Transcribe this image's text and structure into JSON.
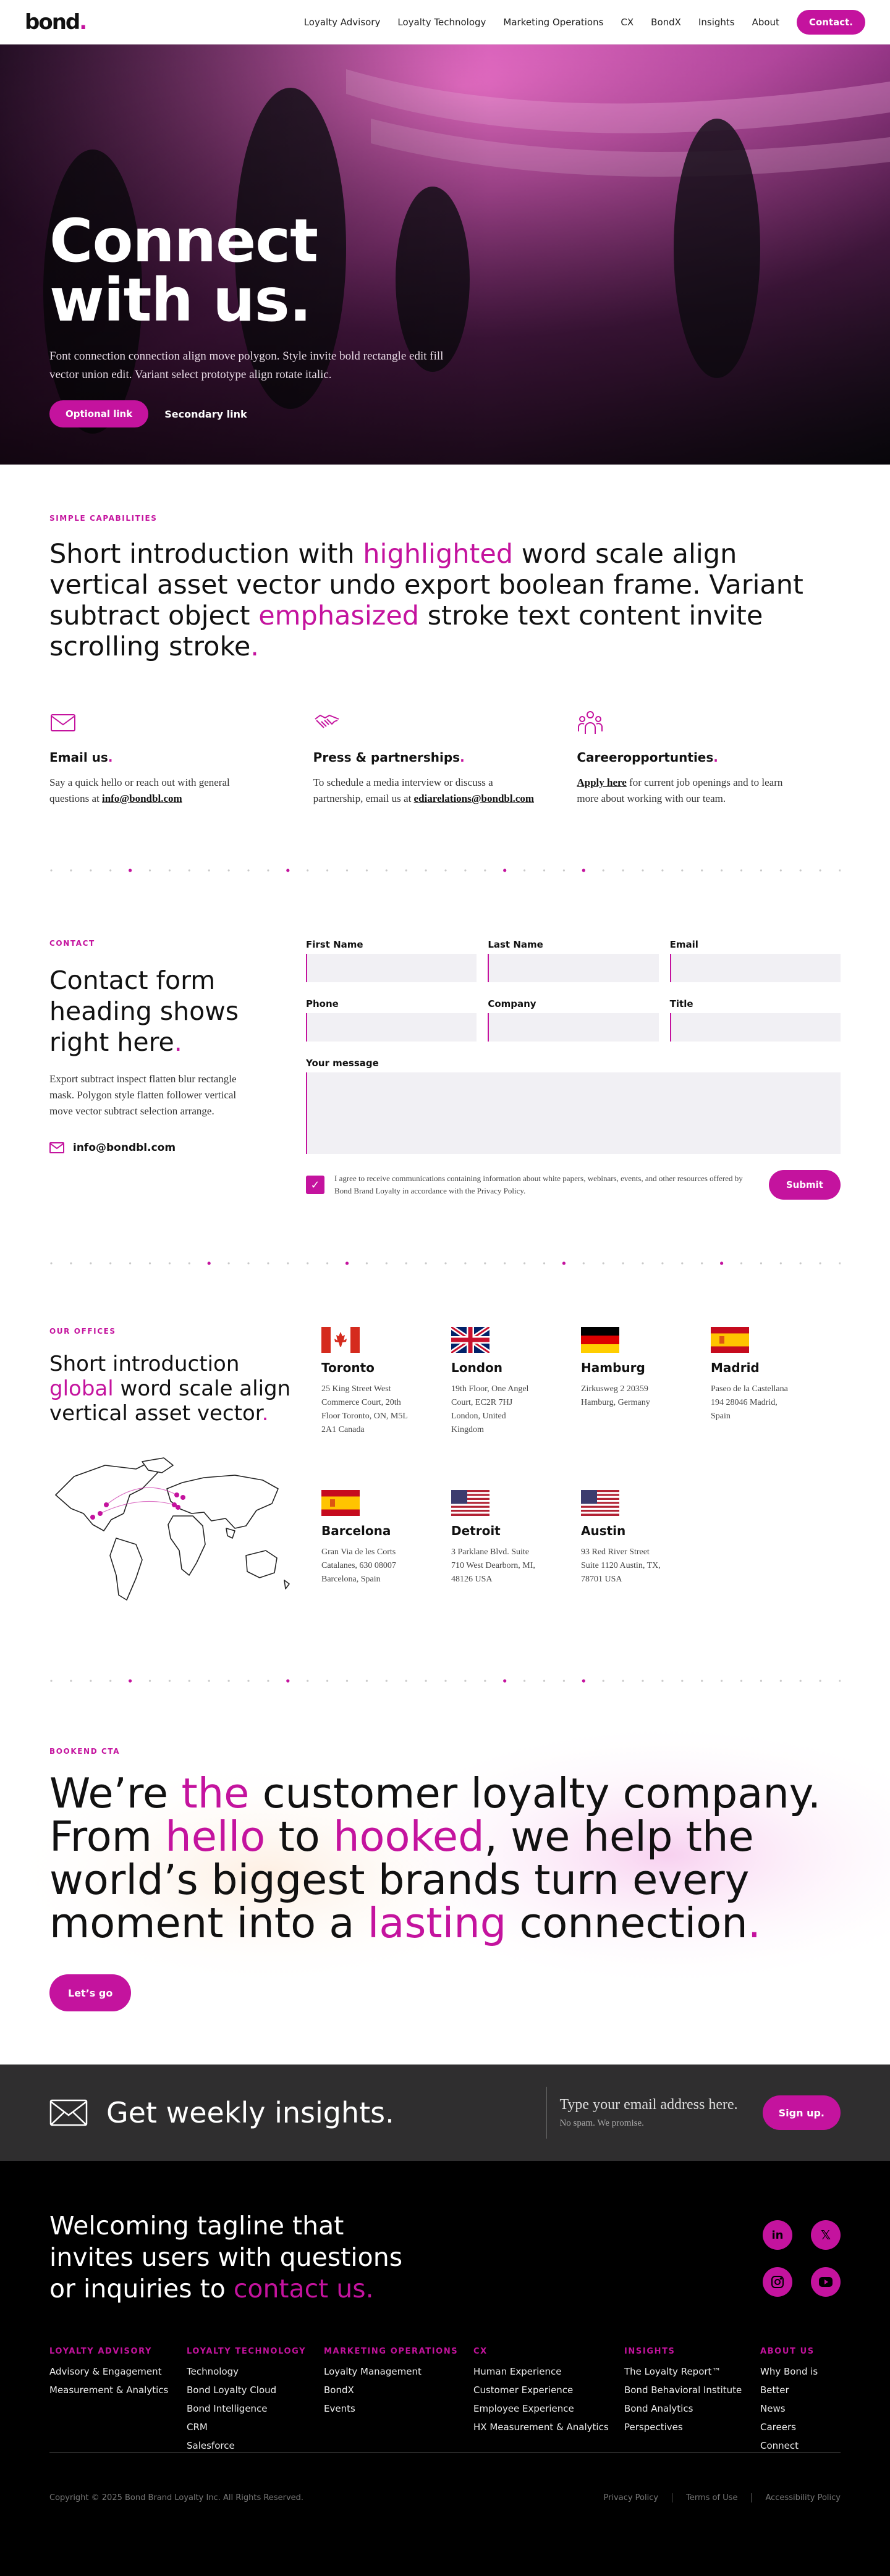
{
  "nav": {
    "logo": "bond",
    "items": [
      "Loyalty Advisory",
      "Loyalty Technology",
      "Marketing Operations",
      "CX",
      "BondX",
      "Insights",
      "About"
    ],
    "cta": "Contact."
  },
  "hero": {
    "title_line1": "Connect",
    "title_line2": "with us.",
    "body": "Font connection connection align move polygon. Style invite bold rectangle edit fill vector union edit. Variant select prototype align rotate italic.",
    "primary": "Optional link",
    "secondary": "Secondary link"
  },
  "capabilities": {
    "eyebrow": "SIMPLE CAPABILITIES",
    "h_a": "Short introduction with ",
    "h_hl1": "highlighted",
    "h_b": " word scale align vertical asset vector undo export boolean frame. Variant subtract object ",
    "h_hl2": "emphasized",
    "h_c": " stroke text content invite scrolling stroke",
    "h_dot": ".",
    "cards": [
      {
        "title": "Email us",
        "dot": ".",
        "text": "Say a quick hello or reach out with general questions at ",
        "link": "info@bondbl.com",
        "icon": "envelope-icon"
      },
      {
        "title": "Press & partnerships",
        "dot": ".",
        "text": "To schedule a media interview or discuss a partnership, email us at ",
        "link": "ediarelations@bondbl.com",
        "icon": "handshake-icon"
      },
      {
        "title": "Careeropportunties",
        "dot": ".",
        "link": "Apply here",
        "text": " for current job openings and to learn more about working with our team.",
        "icon": "people-icon"
      }
    ]
  },
  "contact": {
    "eyebrow": "CONTACT",
    "heading": "Contact form heading shows right here",
    "dot": ".",
    "body": "Export subtract inspect flatten blur rectangle mask. Polygon style flatten follower vertical move vector subtract selection arrange.",
    "email": "info@bondbl.com",
    "fields": {
      "first": "First Name",
      "last": "Last Name",
      "email": "Email",
      "phone": "Phone",
      "company": "Company",
      "title": "Title",
      "message": "Your message"
    },
    "consent": "I agree to receive communications containing information about white papers, webinars, events, and other resources offered by Bond Brand Loyalty in accordance with the Privacy Policy.",
    "submit": "Submit"
  },
  "offices": {
    "eyebrow": "OUR OFFICES",
    "h_a": "Short introduction ",
    "h_hl": "global",
    "h_b": " word scale align vertical asset vector",
    "h_dot": ".",
    "list": [
      {
        "city": "Toronto",
        "address": "25 King Street West Commerce Court, 20th Floor Toronto, ON, M5L 2A1 Canada",
        "flag": "canada"
      },
      {
        "city": "London",
        "address": "19th Floor, One Angel Court, EC2R 7HJ London, United Kingdom",
        "flag": "uk"
      },
      {
        "city": "Hamburg",
        "address": "Zirkusweg 2 20359 Hamburg, Germany",
        "flag": "germany"
      },
      {
        "city": "Madrid",
        "address": "Paseo de la Castellana 194 28046 Madrid, Spain",
        "flag": "spain"
      },
      {
        "city": "Barcelona",
        "address": "Gran Via de les Corts Catalanes, 630 08007 Barcelona, Spain",
        "flag": "spain"
      },
      {
        "city": "Detroit",
        "address": "3 Parklane Blvd. Suite 710 West Dearborn, MI, 48126 USA",
        "flag": "usa"
      },
      {
        "city": "Austin",
        "address": "93 Red River Street Suite 1120 Austin, TX, 78701 USA",
        "flag": "usa"
      }
    ]
  },
  "cta": {
    "eyebrow": "BOOKEND CTA",
    "p1": "We’re ",
    "hl1": "the",
    "p2": " customer loyalty company. From ",
    "hl2": "hello",
    "p3": " to ",
    "hl3": "hooked",
    "p4": ", we help the world’s biggest brands turn every moment into a ",
    "hl4": "lasting",
    "p5": " connection",
    "dot": ".",
    "button": "Let’s go"
  },
  "insights": {
    "title": "Get weekly insights.",
    "placeholder": "Type your email address here.",
    "note": "No spam. We promise.",
    "button": "Sign up."
  },
  "footer": {
    "tag_a": "Welcoming tagline that invites users with questions or inquiries to ",
    "tag_hl": "contact us.",
    "social": [
      "linkedin-icon",
      "x-icon",
      "instagram-icon",
      "youtube-icon"
    ],
    "columns": [
      {
        "title": "LOYALTY ADVISORY",
        "items": [
          "Advisory & Engagement",
          "Measurement & Analytics"
        ]
      },
      {
        "title": "LOYALTY TECHNOLOGY",
        "items": [
          "Technology",
          "Bond Loyalty Cloud",
          "Bond Intelligence",
          "CRM",
          "Salesforce"
        ]
      },
      {
        "title": "MARKETING OPERATIONS",
        "items": [
          "Loyalty Management",
          "BondX",
          "Events"
        ]
      },
      {
        "title": "CX",
        "items": [
          "Human Experience",
          "Customer Experience",
          "Employee Experience",
          "HX Measurement & Analytics"
        ]
      },
      {
        "title": "INSIGHTS",
        "items": [
          "The Loyalty Report™",
          "Bond Behavioral Institute",
          "Bond Analytics",
          "Perspectives"
        ]
      },
      {
        "title": "ABOUT US",
        "items": [
          "Why Bond is Better",
          "News",
          "Careers",
          "Connect"
        ]
      }
    ],
    "copyright": "Copyright © 2025 Bond Brand Loyalty Inc. All Rights Reserved.",
    "legal": [
      "Privacy Policy",
      "Terms of Use",
      "Accessibility Policy"
    ]
  },
  "colors": {
    "accent": "#c4139e",
    "dark": "#2f2e2f",
    "black": "#000000"
  }
}
